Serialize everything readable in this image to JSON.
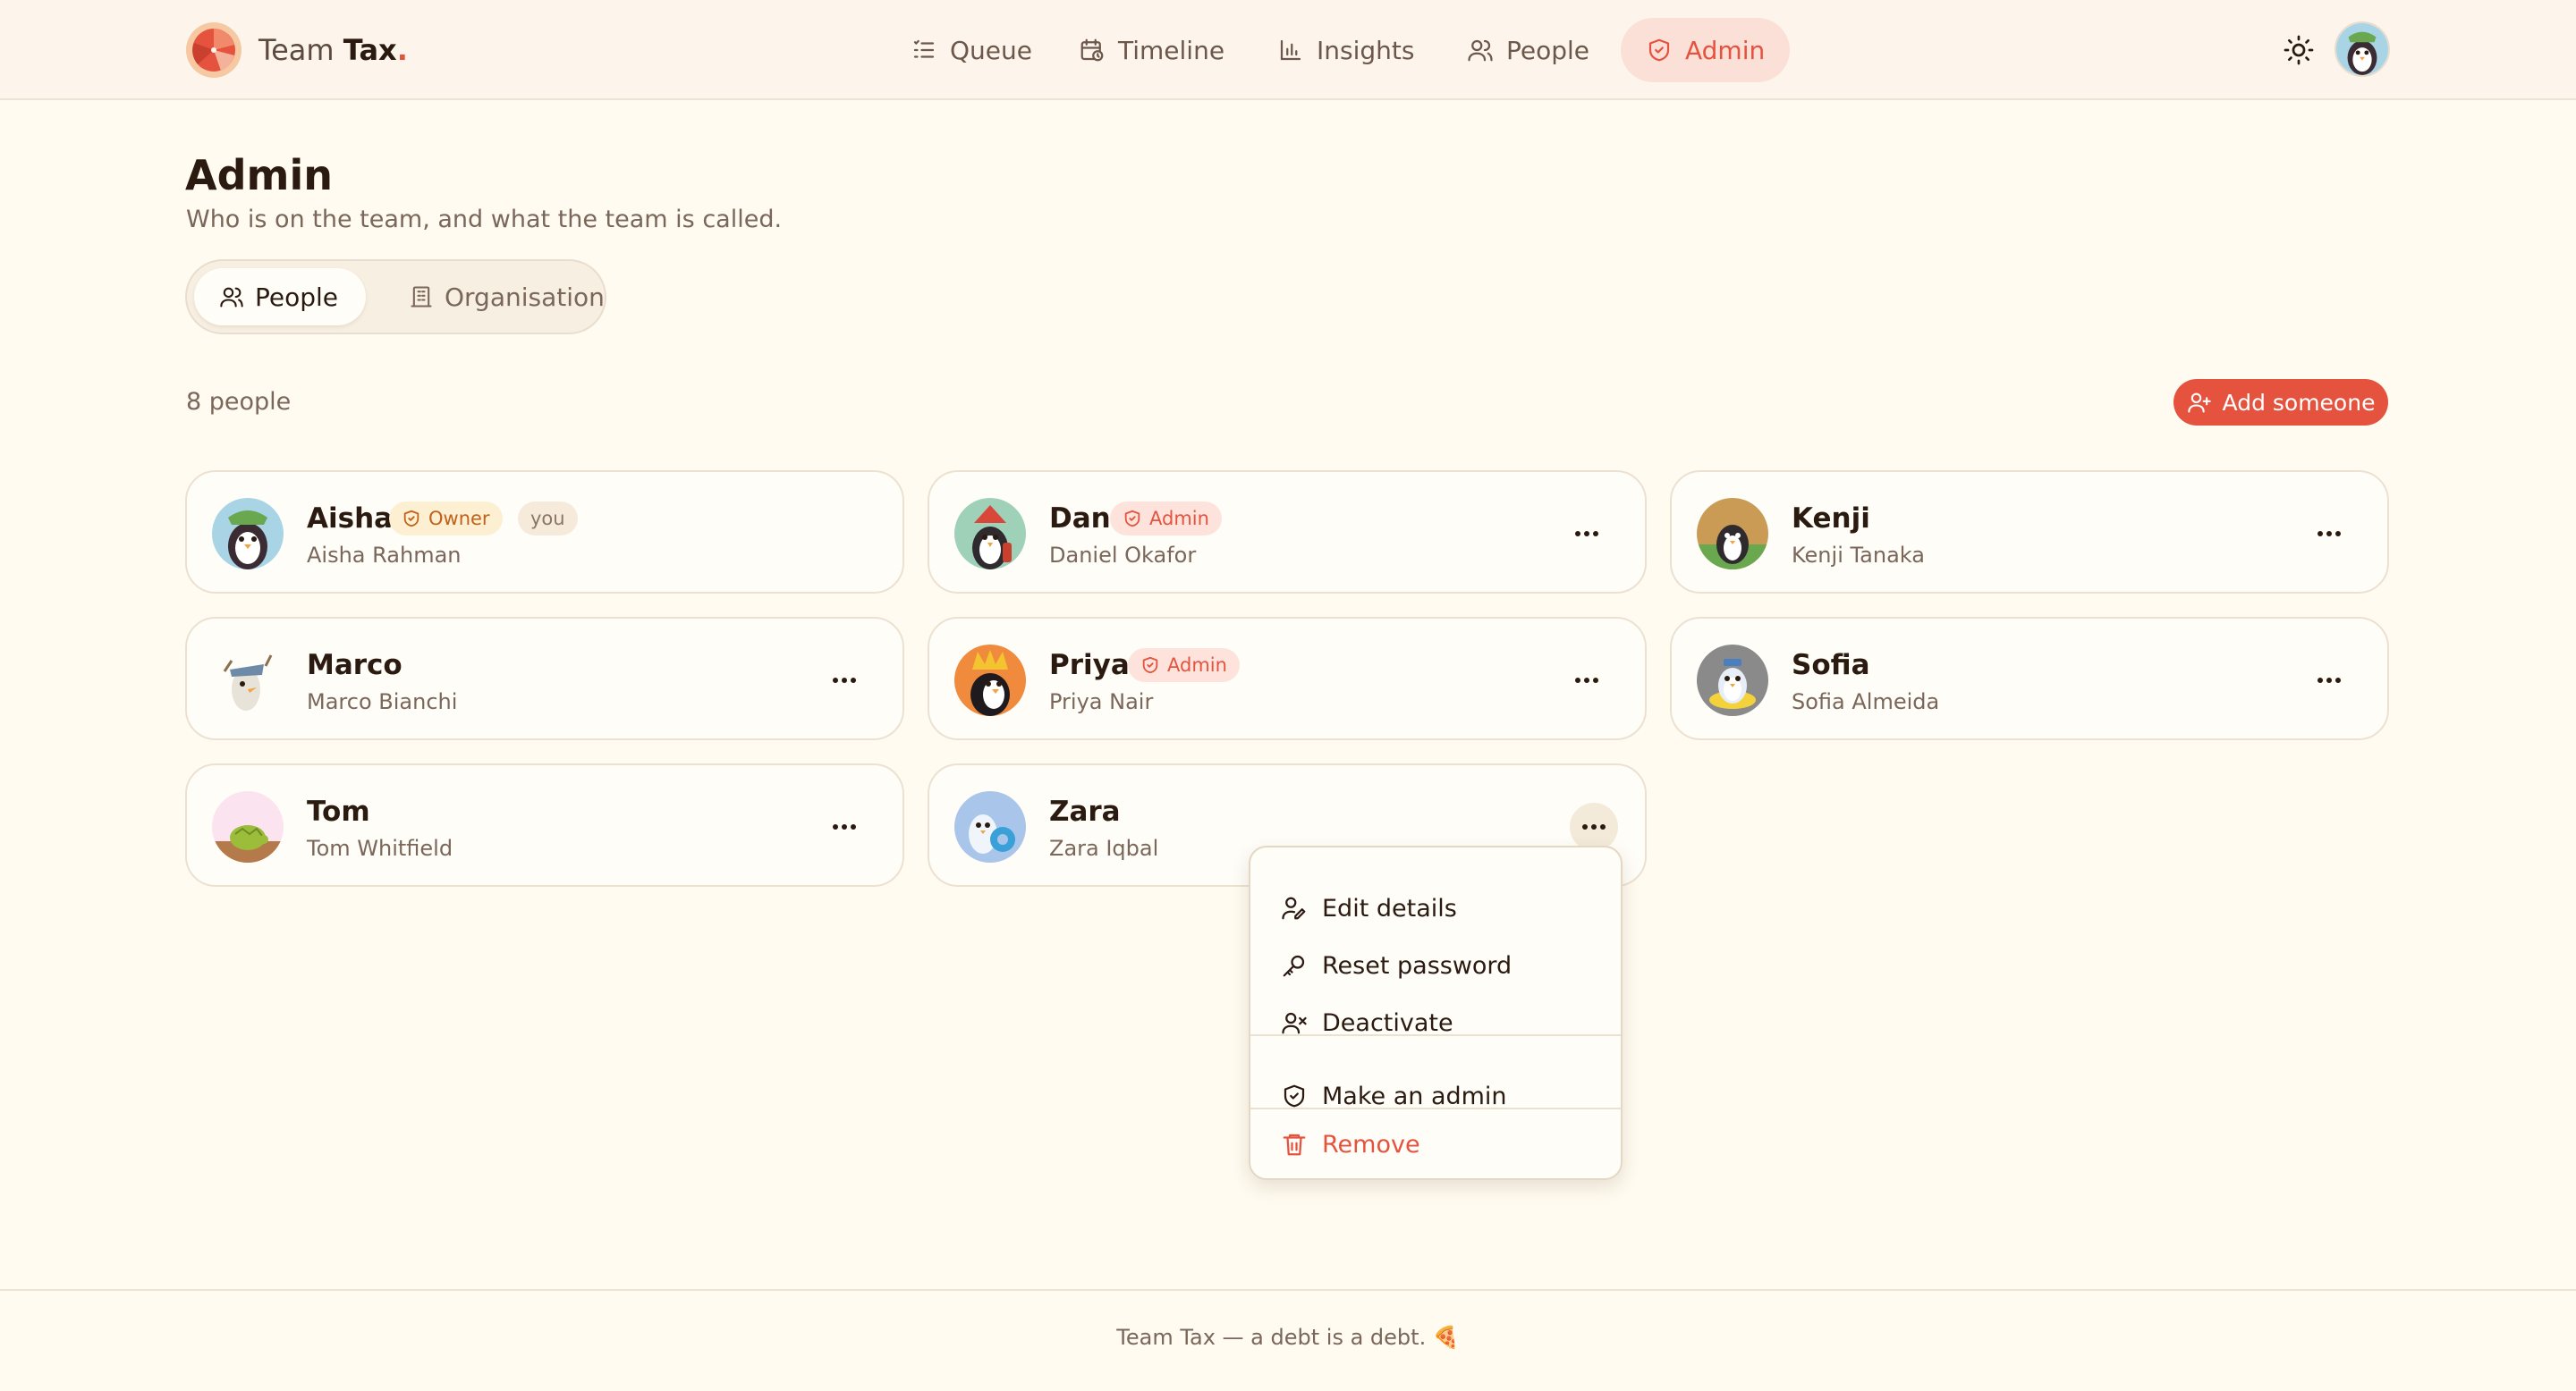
{
  "app": {
    "brand_main": "Team",
    "brand_bold": "Tax",
    "brand_dot": "."
  },
  "nav": [
    {
      "label": "Queue",
      "icon": "list-icon"
    },
    {
      "label": "Timeline",
      "icon": "calendar-clock-icon"
    },
    {
      "label": "Insights",
      "icon": "bar-chart-icon"
    },
    {
      "label": "People",
      "icon": "users-icon"
    },
    {
      "label": "Admin",
      "icon": "shield-icon",
      "active": true
    }
  ],
  "page": {
    "title": "Admin",
    "subtitle": "Who is on the team, and what the team is called."
  },
  "tabs": [
    {
      "label": "People",
      "active": true
    },
    {
      "label": "Organisation",
      "active": false
    }
  ],
  "count_label": "8 people",
  "add_button": "Add someone",
  "people": [
    {
      "nick": "Aisha",
      "full": "Aisha Rahman",
      "badge": "Owner",
      "you": "you"
    },
    {
      "nick": "Dan",
      "full": "Daniel Okafor",
      "badge": "Admin"
    },
    {
      "nick": "Kenji",
      "full": "Kenji Tanaka"
    },
    {
      "nick": "Marco",
      "full": "Marco Bianchi"
    },
    {
      "nick": "Priya",
      "full": "Priya Nair",
      "badge": "Admin"
    },
    {
      "nick": "Sofia",
      "full": "Sofia Almeida"
    },
    {
      "nick": "Tom",
      "full": "Tom Whitfield"
    },
    {
      "nick": "Zara",
      "full": "Zara Iqbal"
    }
  ],
  "menu": {
    "edit": "Edit details",
    "reset": "Reset password",
    "deactivate": "Deactivate",
    "make_admin": "Make an admin",
    "remove": "Remove"
  },
  "footer": "Team Tax — a debt is a debt. 🍕",
  "colors": {
    "accent": "#e5533f",
    "background": "#fffbf0",
    "header": "#fdf5ec",
    "owner_badge": "#fcefd2",
    "admin_badge": "#fde3dc"
  }
}
